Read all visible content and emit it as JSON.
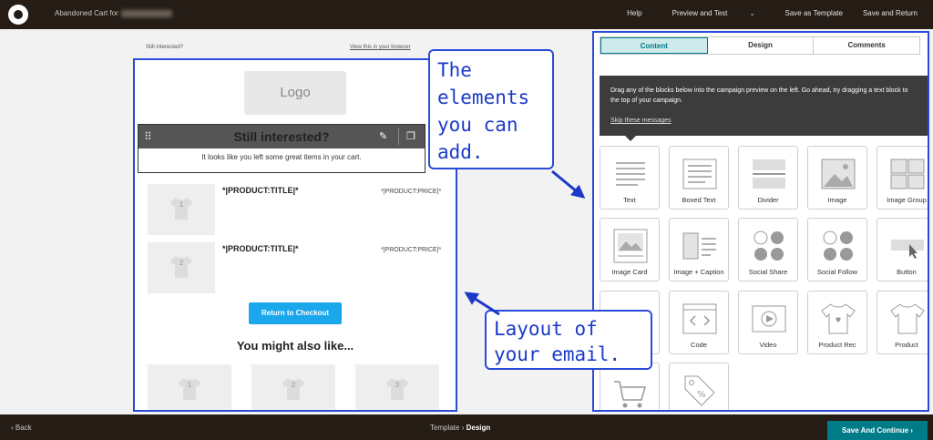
{
  "topbar": {
    "title_prefix": "Abandoned Cart for",
    "nav": [
      "Help",
      "Preview and Test",
      "Save as Template",
      "Save and Return"
    ]
  },
  "preview": {
    "still_small": "Still interested?",
    "view_browser": "View this in your browser",
    "logo": "Logo",
    "heading": "Still interested?",
    "body_text": "It looks like you left some great items in your cart.",
    "products": [
      {
        "num": "1",
        "title": "*|PRODUCT:TITLE|*",
        "price": "*|PRODUCT:PRICE|*"
      },
      {
        "num": "2",
        "title": "*|PRODUCT:TITLE|*",
        "price": "*|PRODUCT:PRICE|*"
      }
    ],
    "checkout_button": "Return to Checkout",
    "also_like": "You might also like...",
    "recs": [
      "1",
      "2",
      "3"
    ]
  },
  "panel": {
    "tabs": [
      "Content",
      "Design",
      "Comments"
    ],
    "tip_text": "Drag any of the blocks below into the campaign preview on the left. Go ahead, try dragging a text block to the top of your campaign.",
    "tip_link": "Skip these messages",
    "blocks": [
      "Text",
      "Boxed Text",
      "Divider",
      "Image",
      "Image Group",
      "Image Card",
      "Image + Caption",
      "Social Share",
      "Social Follow",
      "Button",
      "",
      "Code",
      "Video",
      "Product Rec",
      "Product",
      "",
      ""
    ]
  },
  "annotations": {
    "elements_note": "The elements you can add.",
    "layout_note": "Layout of your email."
  },
  "bottombar": {
    "back": "Back",
    "crumb_1": "Template",
    "crumb_2": "Design",
    "save_continue": "Save And Continue"
  },
  "colors": {
    "header": "#241c15",
    "accent": "#007c89",
    "button": "#1aa7ec",
    "annotation": "#2a4bd7"
  }
}
